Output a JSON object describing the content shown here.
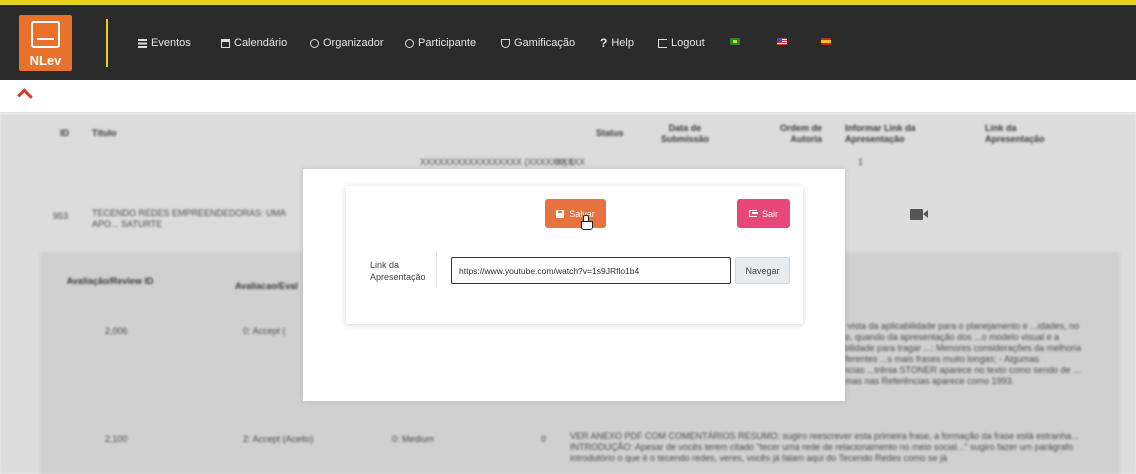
{
  "app": {
    "logo_text": "NLev",
    "colors": {
      "navbar": "#2b2b2b",
      "accent_strip": "#e8d21a",
      "logo_bg": "#e8722c",
      "save": "#e8723f",
      "exit": "#e8477a"
    }
  },
  "nav": {
    "items": [
      {
        "label": "Eventos",
        "icon": "list-icon"
      },
      {
        "label": "Calendário",
        "icon": "calendar-icon"
      },
      {
        "label": "Organizador",
        "icon": "user-icon"
      },
      {
        "label": "Participante",
        "icon": "at-icon"
      },
      {
        "label": "Gamificação",
        "icon": "trophy-icon"
      },
      {
        "label": "Help",
        "icon": "question-icon",
        "prefix": "?"
      },
      {
        "label": "Logout",
        "icon": "logout-icon"
      }
    ],
    "flags": [
      "flag-brazil",
      "flag-usa",
      "flag-spain"
    ]
  },
  "table": {
    "headers": {
      "id": "ID",
      "titulo": "Título",
      "status": "Status",
      "data_submissao": "Data de Submissão",
      "ordem_autoria": "Ordem de Autoria",
      "informar_link": "Informar Link da Apresentação",
      "link_apresentacao": "Link da Apresentação"
    },
    "row_top": {
      "title_fragment": "XXXXXXXXXXXXXXXXX (XXXXXX) 1",
      "extra": "XXXXX",
      "ordem": "1"
    },
    "row": {
      "id": "953",
      "title": "TECENDO REDES EMPREENDEDORAS: UMA APO... SATURTE"
    },
    "review_headers": {
      "review_id": "Avaliação/Review ID",
      "avaliacao": "Avaliacao/Eval"
    },
    "reviews": [
      {
        "id": "2,006",
        "avaliacao": "0: Accept (",
        "comment": "...a de vista da aplicabilidade para o planejamento e ...idades, no entanto, quando da apresentação dos ...o modelo visual e a aplicabilidade para tragar ...: Menores considerações da melhoria são referentes ...s mais frases muito longas; - Algumas referências ...trênia STONER aparece no texto como sendo de ... 1995, mas nas Referências aparece como 1993."
      },
      {
        "id": "2,100",
        "avaliacao": "2: Accept (Aceito)",
        "nota": "0: Medium",
        "num": "0",
        "comment": "VER ANEXO PDF COM COMENTÁRIOS RESUMO: sugiro reescrever esta primeira frase, a formação da frase está estranha... INTRODUÇÃO: Apesar de vocês terem citado \"tecer uma rede de relacionamento no meio social...\" sugiro fazer um parágrafo introdutório o que é o tecendo redes, veres, vocês já falam aqui do Tecendo Redes como se já"
      }
    ]
  },
  "modal": {
    "save_label": "Salvar",
    "exit_label": "Sair",
    "field_label": "Link da Apresentação",
    "link_value": "https://www.youtube.com/watch?v=1s9JRflo1b4",
    "navigate_label": "Navegar"
  }
}
